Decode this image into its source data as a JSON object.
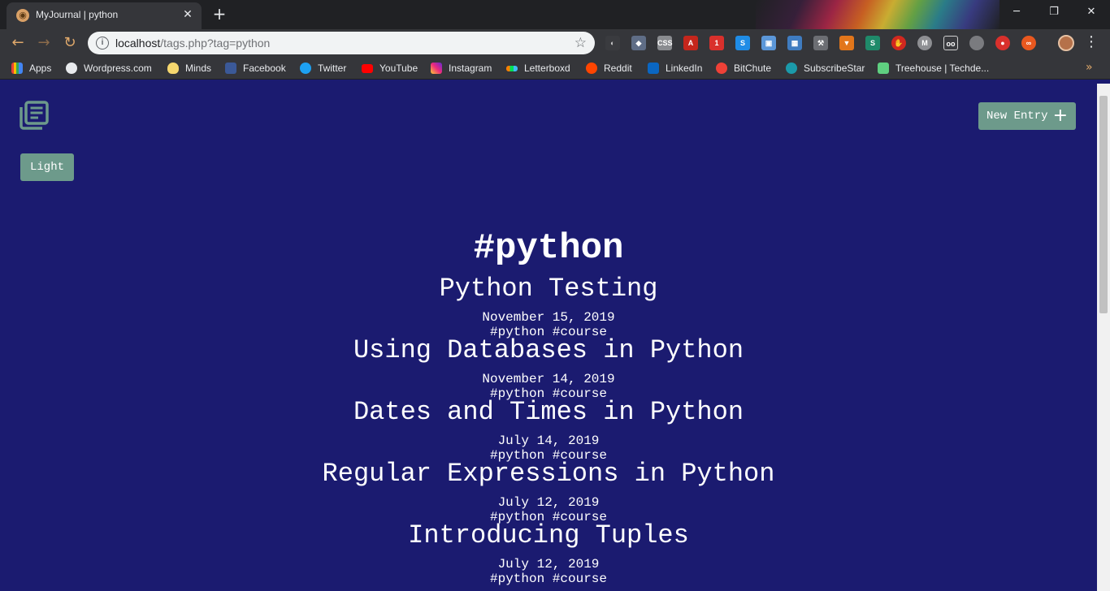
{
  "browser": {
    "tab_title": "MyJournal | python",
    "url_host": "localhost",
    "url_path": "/tags.php?tag=python",
    "bookmarks": [
      "Apps",
      "Wordpress.com",
      "Minds",
      "Facebook",
      "Twitter",
      "YouTube",
      "Instagram",
      "Letterboxd",
      "Reddit",
      "LinkedIn",
      "BitChute",
      "SubscribeStar",
      "Treehouse | Techde..."
    ],
    "extension_badge": "1"
  },
  "page": {
    "theme_button": "Light",
    "new_entry_button": "New Entry",
    "tag_heading": "#python",
    "entries": [
      {
        "title": "Python Testing",
        "date": "November 15, 2019",
        "tags": "#python #course"
      },
      {
        "title": "Using Databases in Python",
        "date": "November 14, 2019",
        "tags": "#python #course"
      },
      {
        "title": "Dates and Times in Python",
        "date": "July 14, 2019",
        "tags": "#python #course"
      },
      {
        "title": "Regular Expressions in Python",
        "date": "July 12, 2019",
        "tags": "#python #course"
      },
      {
        "title": "Introducing Tuples",
        "date": "July 12, 2019",
        "tags": "#python #course"
      }
    ]
  },
  "colors": {
    "page_background": "#1b1b70",
    "button_accent": "#6d9a8b",
    "logo": "#6d9a8b",
    "chrome_dark": "#35363a"
  }
}
